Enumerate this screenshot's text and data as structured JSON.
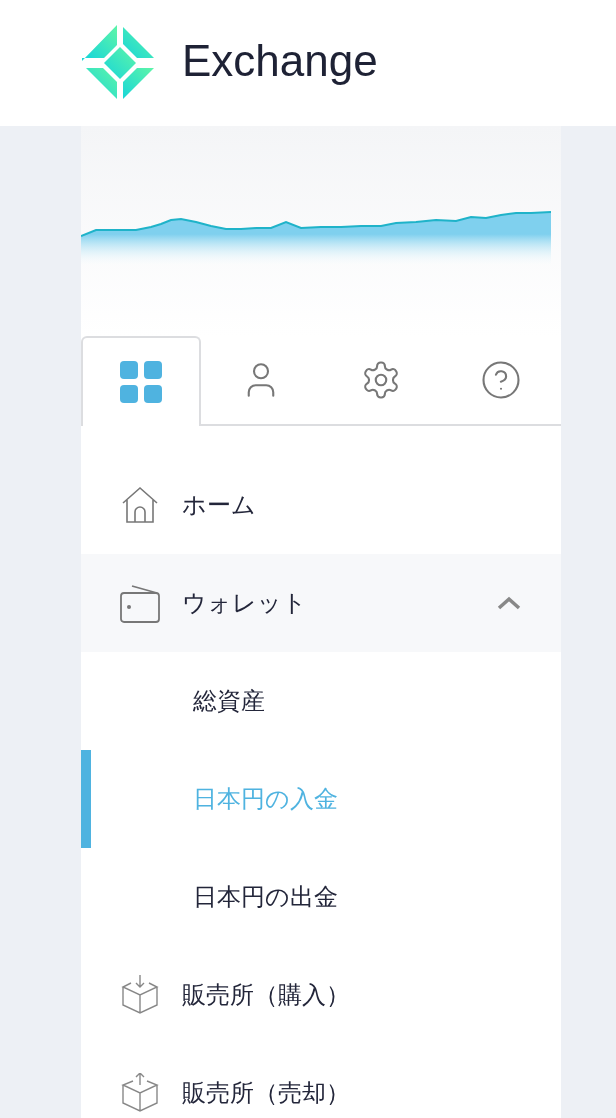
{
  "header": {
    "title": "Exchange"
  },
  "tabs": [
    {
      "kind": "grid",
      "selected": true
    },
    {
      "kind": "user",
      "selected": false
    },
    {
      "kind": "settings",
      "selected": false
    },
    {
      "kind": "help",
      "selected": false
    }
  ],
  "menu": [
    {
      "kind": "home",
      "label": "ホーム"
    },
    {
      "kind": "wallet",
      "label": "ウォレット",
      "expanded": true,
      "children": [
        {
          "label": "総資産",
          "selected": false
        },
        {
          "label": "日本円の入金",
          "selected": true
        },
        {
          "label": "日本円の出金",
          "selected": false
        }
      ]
    },
    {
      "kind": "buy",
      "label": "販売所（購入）"
    },
    {
      "kind": "sell",
      "label": "販売所（売却）"
    }
  ]
}
